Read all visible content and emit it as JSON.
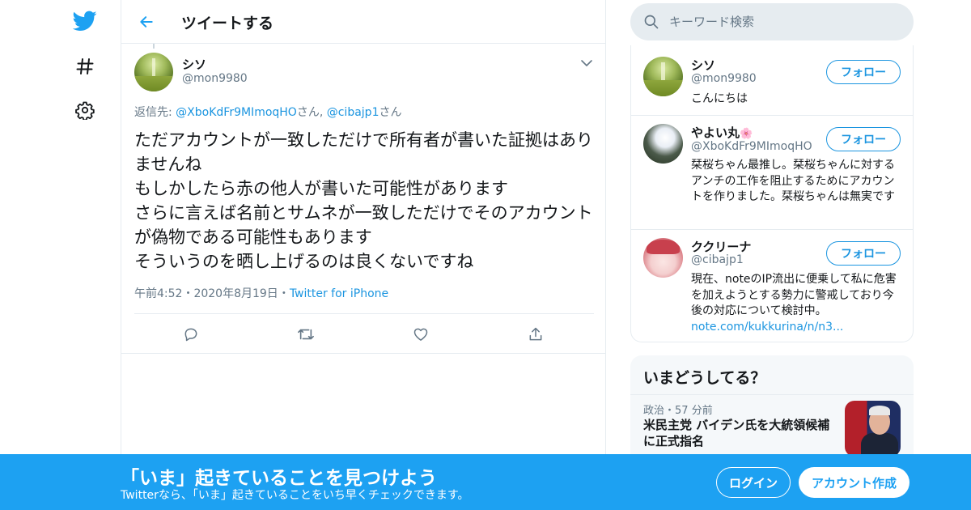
{
  "colors": {
    "brand": "#1da1f2",
    "link": "#1b95e0",
    "muted": "#657786",
    "border": "#e6ecf0",
    "text": "#14171a"
  },
  "left_nav": {
    "items": [
      {
        "icon": "twitter-bird-icon"
      },
      {
        "icon": "hashtag-icon"
      },
      {
        "icon": "gear-icon"
      }
    ]
  },
  "header": {
    "title": "ツイートする",
    "back_icon": "arrow-left-icon"
  },
  "tweet": {
    "author_name": "シソ",
    "author_handle": "@mon9980",
    "reply_prefix": "返信先: ",
    "reply_user_1": "@XboKdFr9MImoqHO",
    "reply_sep_1": "さん, ",
    "reply_user_2": "@cibajp1",
    "reply_suffix": "さん",
    "text": "ただアカウントが一致しただけで所有者が書いた証拠はありませんね\nもしかしたら赤の他人が書いた可能性があります\nさらに言えば名前とサムネが一致しただけでそのアカウントが偽物である可能性もあります\nそういうのを晒し上げるのは良くないですね",
    "time": "午前4:52",
    "dot": "・",
    "date": "2020年8月19日",
    "source": "Twitter for iPhone",
    "actions": [
      "reply-icon",
      "retweet-icon",
      "like-icon",
      "share-icon"
    ]
  },
  "search": {
    "placeholder": "キーワード検索"
  },
  "users": [
    {
      "name": "シソ",
      "handle": "@mon9980",
      "follow": "フォロー",
      "bio": "こんにちは",
      "bio_link": ""
    },
    {
      "name": "やよい丸",
      "name_emoji": "🌸",
      "handle": "@XboKdFr9MImoqHO",
      "follow": "フォロー",
      "bio": "栞桜ちゃん最推し。栞桜ちゃんに対するアンチの工作を阻止するためにアカウントを作りました。栞桜ちゃんは無実です",
      "bio_link": ""
    },
    {
      "name": "ククリーナ",
      "handle": "@cibajp1",
      "follow": "フォロー",
      "bio": "現在、noteのIP流出に便乗して私に危害を加えようとする勢力に警戒しており今後の対応について検討中。",
      "bio_link": "note.com/kukkurina/n/n3..."
    }
  ],
  "trends": {
    "title": "いまどうしてる？",
    "item": {
      "category": "政治",
      "dot": "・",
      "time": "57 分前",
      "headline": "米民主党 バイデン氏を大統領候補に正式指名"
    }
  },
  "banner": {
    "title": "「いま」起きていることを見つけよう",
    "subtitle": "Twitterなら、「いま」起きていることをいち早くチェックできます。",
    "login": "ログイン",
    "signup": "アカウント作成"
  }
}
